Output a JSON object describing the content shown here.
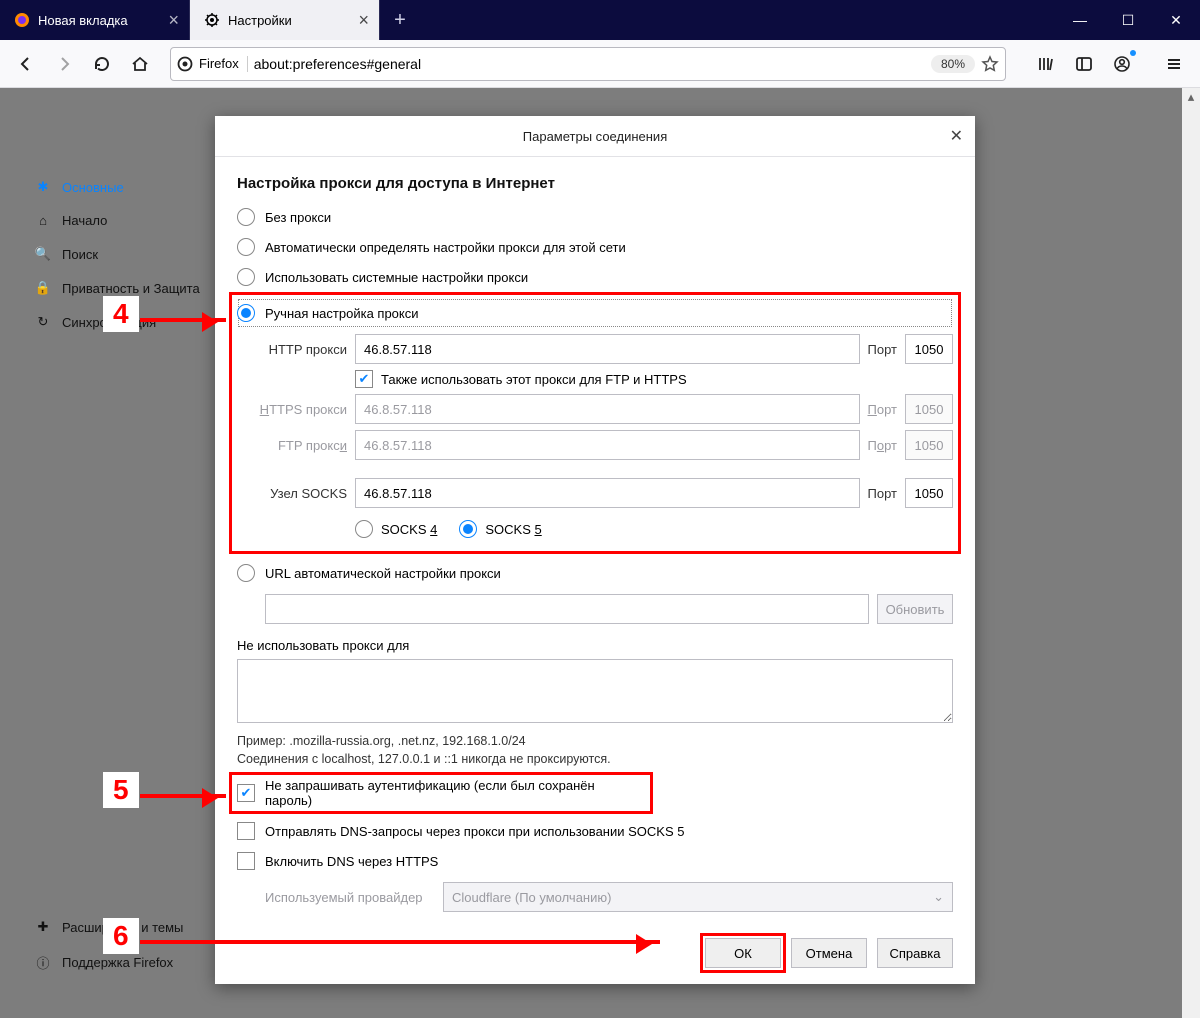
{
  "window": {
    "tabs": [
      {
        "label": "Новая вкладка",
        "active": false
      },
      {
        "label": "Настройки",
        "active": true
      }
    ],
    "controls": {
      "min": "—",
      "max": "☐",
      "close": "✕"
    }
  },
  "toolbar": {
    "brand": "Firefox",
    "url": "about:preferences#general",
    "zoom": "80%"
  },
  "sidebar": {
    "items": [
      {
        "icon": "gear",
        "label": "Основные",
        "selected": true
      },
      {
        "icon": "home",
        "label": "Начало"
      },
      {
        "icon": "search",
        "label": "Поиск"
      },
      {
        "icon": "lock",
        "label": "Приватность и Защита"
      },
      {
        "icon": "sync",
        "label": "Синхронизация"
      }
    ],
    "footer": [
      {
        "icon": "puzzle",
        "label": "Расширения и темы"
      },
      {
        "icon": "help",
        "label": "Поддержка Firefox"
      }
    ]
  },
  "dialog": {
    "title": "Параметры соединения",
    "section_heading": "Настройка прокси для доступа в Интернет",
    "radios": {
      "none": "Без прокси",
      "auto": "Автоматически определять настройки прокси для этой сети",
      "system": "Использовать системные настройки прокси",
      "manual": "Ручная настройка прокси",
      "pac": "URL автоматической настройки прокси"
    },
    "fields": {
      "http_label": "HTTP прокси",
      "https_label": "HTTPS прокси",
      "ftp_label": "FTP прокси",
      "socks_label": "Узел SOCKS",
      "port_label": "Порт",
      "http_host": "46.8.57.118",
      "http_port": "1050",
      "https_host": "46.8.57.118",
      "https_port": "1050",
      "ftp_host": "46.8.57.118",
      "ftp_port": "1050",
      "socks_host": "46.8.57.118",
      "socks_port": "1050",
      "share_label": "Также использовать этот прокси для FTP и HTTPS",
      "socks4": "SOCKS 4",
      "socks5": "SOCKS 5",
      "update_btn": "Обновить"
    },
    "noproxy_label": "Не использовать прокси для",
    "hint1": "Пример: .mozilla-russia.org, .net.nz, 192.168.1.0/24",
    "hint2": "Соединения с localhost, 127.0.0.1 и ::1 никогда не проксируются.",
    "checks": {
      "noauth": "Не запрашивать аутентификацию (если был сохранён пароль)",
      "dns_socks": "Отправлять DNS-запросы через прокси при использовании SOCKS 5",
      "doh": "Включить DNS через HTTPS"
    },
    "provider_label": "Используемый провайдер",
    "provider_value": "Cloudflare (По умолчанию)",
    "buttons": {
      "ok": "ОК",
      "cancel": "Отмена",
      "help": "Справка"
    }
  },
  "annotations": {
    "n4": "4",
    "n5": "5",
    "n6": "6"
  }
}
